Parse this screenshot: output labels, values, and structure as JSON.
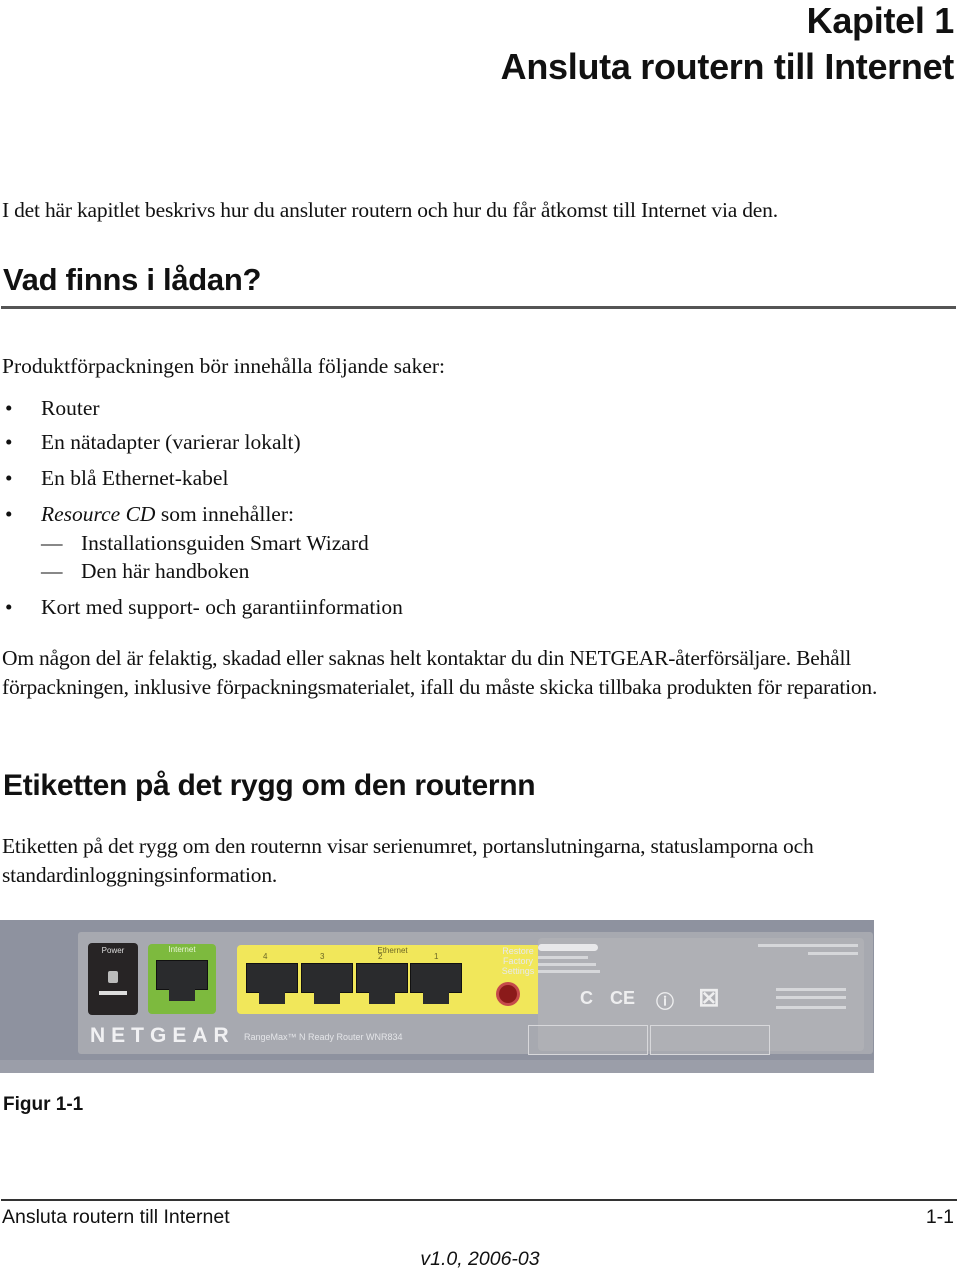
{
  "header": {
    "chapter_label": "Kapitel 1",
    "chapter_title": "Ansluta routern till Internet"
  },
  "intro": "I det här kapitlet beskrivs hur du ansluter routern och hur du får åtkomst till Internet via den.",
  "section_box": {
    "heading": "Vad finns i lådan?",
    "lead": "Produktförpackningen bör innehålla följande saker:",
    "bullet_glyph": "•",
    "dash_glyph": "—",
    "items": [
      {
        "text": "Router"
      },
      {
        "text": "En nätadapter (varierar lokalt)"
      },
      {
        "text": "En blå Ethernet-kabel"
      },
      {
        "italic": "Resource CD",
        "text": " som innehåller:",
        "subitems": [
          "Installationsguiden Smart Wizard",
          "Den här handboken"
        ]
      },
      {
        "text": "Kort med support- och garantiinformation"
      }
    ],
    "note": "Om någon del är felaktig, skadad eller saknas helt kontaktar du din NETGEAR-återförsäljare. Behåll förpackningen, inklusive förpackningsmaterialet, ifall du måste skicka tillbaka produkten för reparation."
  },
  "section_label": {
    "heading": "Etiketten på det rygg om den routernn",
    "paragraph": "Etiketten på det rygg om den  routernn visar serienumret, portanslutningarna, statuslamporna och standardinloggningsinformation."
  },
  "figure": {
    "caption": "Figur 1-1",
    "router": {
      "power_label": "Power",
      "internet_label": "Internet",
      "ethernet_label": "Ethernet",
      "ethernet_ports": [
        "4",
        "3",
        "2",
        "1"
      ],
      "reset_label": "Restore Factory Settings",
      "brand": "NETGEAR",
      "model": "RangeMax™ N Ready Router WNR834",
      "cert_marks": [
        "C",
        "CE",
        "ⓘ",
        "⊠"
      ],
      "colors": {
        "chassis": "#8e929f",
        "internet_port": "#7dba3e",
        "ethernet_ports": "#f1e75a",
        "power_port": "#272425",
        "reset_button": "#8b1a1a"
      }
    }
  },
  "footer": {
    "title": "Ansluta routern till Internet",
    "page": "1-1",
    "version": "v1.0, 2006-03"
  }
}
